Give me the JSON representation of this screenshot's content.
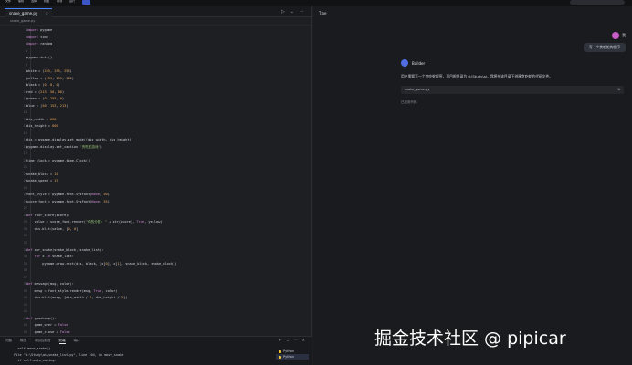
{
  "menu": [
    "文件",
    "编辑",
    "选择",
    "视图",
    "转到",
    "运行"
  ],
  "editor": {
    "tab_label": "snake_game.py",
    "tab_close": "×",
    "breadcrumb": "snake_game.py",
    "actions": [
      "▷",
      "⌄",
      "⋯"
    ],
    "lines": [
      "import pygame",
      "import time",
      "import random",
      "",
      "pygame.init()",
      "",
      "white = (255, 255, 255)",
      "yellow = (255, 255, 102)",
      "black = (0, 0, 0)",
      "red = (213, 50, 80)",
      "green = (0, 255, 0)",
      "blue = (50, 153, 213)",
      "",
      "dis_width = 800",
      "dis_height = 600",
      "",
      "dis = pygame.display.set_mode((dis_width, dis_height))",
      "pygame.display.set_caption('贪吃蛇游戏')",
      "",
      "time_clock = pygame.time.Clock()",
      "",
      "snake_block = 10",
      "snake_speed = 15",
      "",
      "font_style = pygame.font.SysFont(None, 50)",
      "score_font = pygame.font.SysFont(None, 35)",
      "",
      "def Your_score(score):",
      "    value = score_font.render(\"你的分数: \" + str(score), True, yellow)",
      "    dis.blit(value, [0, 0])",
      "",
      "",
      "def our_snake(snake_block, snake_list):",
      "    for x in snake_list:",
      "        pygame.draw.rect(dis, black, [x[0], x[1], snake_block, snake_block])",
      "",
      "",
      "def message(msg, color):",
      "    mesg = font_style.render(msg, True, color)",
      "    dis.blit(mesg, [dis_width / 6, dis_height / 3])",
      "",
      "",
      "def gameLoop():",
      "    game_over = False",
      "    game_close = False",
      "    "
    ]
  },
  "panel": {
    "tabs": [
      "问题",
      "输出",
      "调试控制台",
      "终端",
      "端口"
    ],
    "actions": [
      "+",
      "⌄",
      "⋯",
      "×"
    ],
    "terminal": [
      "    self.move_snake()",
      "  File \"d:\\Study\\ai\\snake_list.py\", line 104, in move_snake",
      "    if self.auto_eating:"
    ],
    "shells": [
      "Python",
      "Python"
    ]
  },
  "chat": {
    "title": "Trae",
    "user_name": "我",
    "user_message": "写一个贪吃蛇的程序",
    "bot_name": "Builder",
    "bot_message": "用户需要写一个贪吃蛇程序，项目根目录为 d:\\Study\\ai，我将在该目录下创建贪吃蛇的代码文件。",
    "file_name": "snake_game.py",
    "file_action": "⧉",
    "applied_label": "已应用代码"
  },
  "watermark": "掘金技术社区 @ pipicar"
}
